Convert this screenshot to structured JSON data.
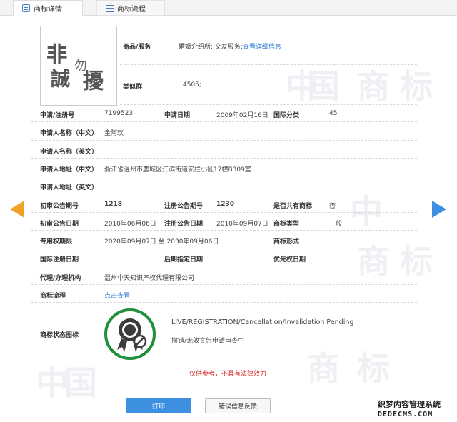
{
  "tabs": [
    {
      "label": "商标详情",
      "active": true
    },
    {
      "label": "商标流程",
      "active": false
    }
  ],
  "logo": {
    "text": "非誠勿擾"
  },
  "goods": {
    "label": "商品/服务",
    "value": "婚姻介绍所; 交友服务;",
    "link": "查看详细信息"
  },
  "similar_group": {
    "label": "类似群",
    "value": "4505;"
  },
  "fields": {
    "reg_no": {
      "label": "申请/注册号",
      "value": "7199523"
    },
    "apply_date": {
      "label": "申请日期",
      "value": "2009年02月16日"
    },
    "intl_class": {
      "label": "国际分类",
      "value": "45"
    },
    "applicant_cn": {
      "label": "申请人名称（中文）",
      "value": "金阿欢"
    },
    "applicant_en": {
      "label": "申请人名称（英文）",
      "value": ""
    },
    "address_cn": {
      "label": "申请人地址（中文）",
      "value": "浙江省温州市鹿城区江滨街道安栏小区17幢B309室"
    },
    "address_en": {
      "label": "申请人地址（英文）",
      "value": ""
    },
    "prelim_pub_no": {
      "label": "初审公告期号",
      "value": "1218"
    },
    "reg_pub_no": {
      "label": "注册公告期号",
      "value": "1230"
    },
    "shared": {
      "label": "是否共有商标",
      "value": "否"
    },
    "prelim_pub_date": {
      "label": "初审公告日期",
      "value": "2010年06月06日"
    },
    "reg_pub_date": {
      "label": "注册公告日期",
      "value": "2010年09月07日"
    },
    "tm_type": {
      "label": "商标类型",
      "value": "一般"
    },
    "exclusive_period": {
      "label": "专用权期限",
      "value": "2020年09月07日 至 2030年09月06日"
    },
    "tm_form": {
      "label": "商标形式",
      "value": ""
    },
    "intl_reg_date": {
      "label": "国际注册日期",
      "value": ""
    },
    "later_date": {
      "label": "后期指定日期",
      "value": ""
    },
    "priority_date": {
      "label": "优先权日期",
      "value": ""
    },
    "agent": {
      "label": "代理/办理机构",
      "value": "温州中天知识产权代理有限公司"
    },
    "flow": {
      "label": "商标流程",
      "link": "点击查看"
    }
  },
  "status": {
    "label": "商标状态图标",
    "en": "LIVE/REGISTRATION/Cancellation/Invalidation Pending",
    "cn": "撤销/无效宣告申请审查中",
    "icon": "award-ribbon-cancel-icon",
    "ring_color": "#1f8f3a"
  },
  "notice": "仅供参考，不具有法律效力",
  "buttons": {
    "print": "打印",
    "feedback": "错误信息反馈"
  },
  "watermark_chars": [
    "中",
    "国",
    "商",
    "标"
  ],
  "site_badge": {
    "line1": "织梦内容管理系统",
    "line2": "DEDECMS.COM"
  },
  "colors": {
    "accent": "#3d8fe0",
    "prev_arrow": "#f0a227",
    "next_arrow": "#3d8fe0",
    "link": "#2a7ad6",
    "notice": "#d92424"
  }
}
